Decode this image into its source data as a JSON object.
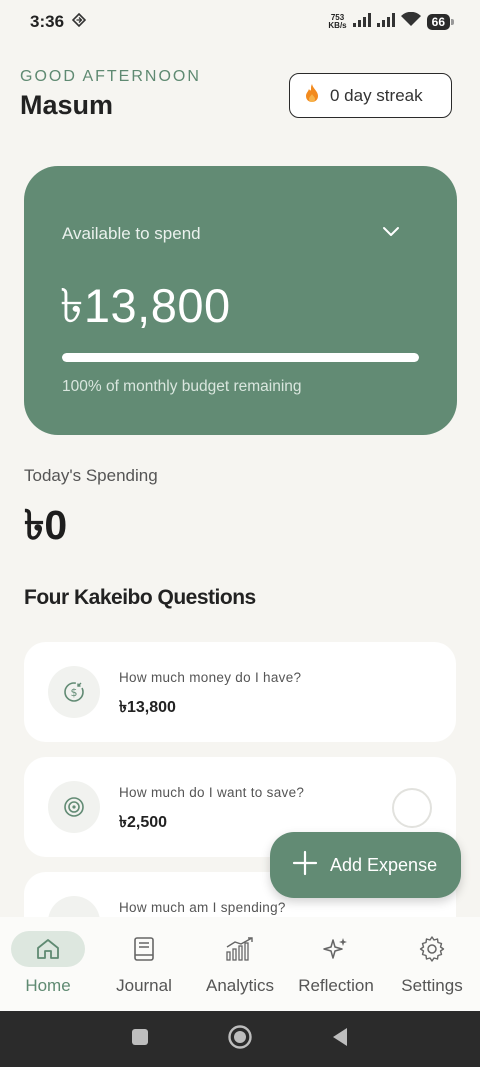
{
  "status_bar": {
    "time": "3:36",
    "net_speed_value": "753",
    "net_speed_unit": "KB/s",
    "battery": "66"
  },
  "header": {
    "greeting": "GOOD AFTERNOON",
    "user_name": "Masum",
    "streak_label": "0 day streak"
  },
  "budget_card": {
    "label": "Available to spend",
    "amount": "৳13,800",
    "progress_fraction": 1.0,
    "remaining_text": "100% of monthly budget remaining"
  },
  "today": {
    "label": "Today's Spending",
    "amount": "৳0"
  },
  "questions": {
    "title": "Four Kakeibo Questions",
    "items": [
      {
        "question": "How much money do I have?",
        "value": "৳13,800",
        "icon": "money-icon"
      },
      {
        "question": "How much do I want to save?",
        "value": "৳2,500",
        "icon": "target-icon"
      },
      {
        "question": "How much am I spending?",
        "value": "",
        "icon": "spending-icon"
      }
    ]
  },
  "fab": {
    "label": "Add Expense"
  },
  "nav": {
    "items": [
      {
        "label": "Home",
        "icon": "home-icon",
        "active": true
      },
      {
        "label": "Journal",
        "icon": "journal-icon"
      },
      {
        "label": "Analytics",
        "icon": "analytics-icon"
      },
      {
        "label": "Reflection",
        "icon": "sparkle-icon"
      },
      {
        "label": "Settings",
        "icon": "gear-icon"
      }
    ]
  },
  "colors": {
    "accent": "#628B74",
    "background": "#F6F5F1",
    "streak_flame": "#F28A1E"
  }
}
